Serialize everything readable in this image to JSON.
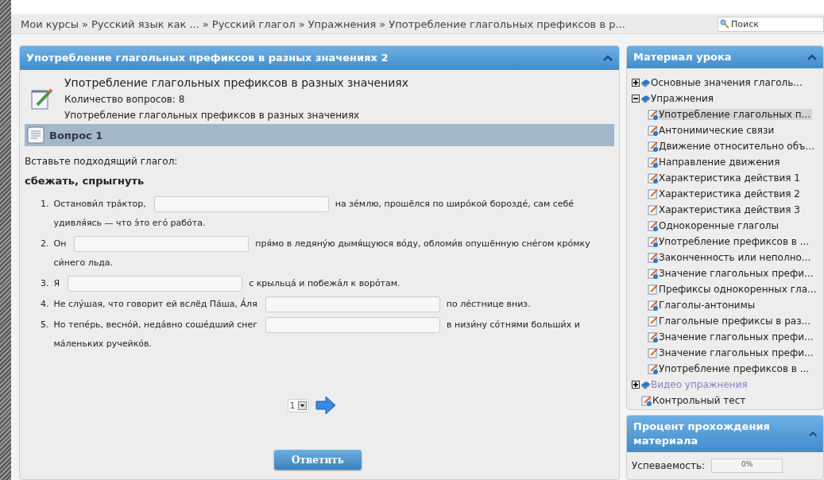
{
  "breadcrumbs": [
    "Мои курсы",
    "Русский язык как ...",
    "Русский глагол",
    "Упражнения",
    "Употребление глагольных префиксов в р..."
  ],
  "breadcrumb_separators": [
    "»",
    "»",
    "»",
    "»"
  ],
  "search": {
    "placeholder": "Поиск"
  },
  "quiz_panel": {
    "title": "Употребление глагольных префиксов в разных значениях 2",
    "quiz_title": "Употребление глагольных префиксов в разных значениях",
    "question_count": "Количество вопросов: 8",
    "description": "Употребление глагольных префиксов в разных значениях",
    "question": {
      "title": "Вопрос 1",
      "instruction": "Вставьте подходящий глагол:",
      "words": "сбежать, спрыгнуть",
      "items": [
        {
          "number": "1.",
          "before": "Останови́л тра́ктор,",
          "after": "на зе́млю, прошёлся по широ́кой борозде́, сам себе́",
          "continuation": "удивля́ясь — что э́то его́ рабо́та."
        },
        {
          "number": "2.",
          "before": "Он",
          "after": "пря́мо в ледяну́ю дымя́щуюся во́ду, обломи́в опушённую сне́гом кро́мку",
          "continuation": "си́него льда."
        },
        {
          "number": "3.",
          "before": "Я",
          "after": "с крыльца́ и побежа́л к воро́там."
        },
        {
          "number": "4.",
          "before": "Не слу́шая, что говорит ей вслёд Па́ша, А́ля",
          "after": "по ле́стнице вниз."
        },
        {
          "number": "5.",
          "before": "Но тепе́рь, весно́й, неда́вно соше́дший снег",
          "after": "в низи́ну со́тнями больши́х и",
          "continuation": "ма́леньких ручейко́в."
        }
      ]
    },
    "page_select": {
      "value": "1"
    },
    "submit_button": "Ответить"
  },
  "material_panel": {
    "title": "Материал урока",
    "tree": [
      {
        "label": "Основные значения глаголь...",
        "kind": "folder",
        "expanded": false,
        "visited": false
      },
      {
        "label": "Упражнения",
        "kind": "folder",
        "expanded": true,
        "visited": false,
        "children": [
          {
            "label": "Употребление глагольных п...",
            "kind": "quiz",
            "selected": true
          },
          {
            "label": "Антонимические связи",
            "kind": "quiz",
            "selected": false
          },
          {
            "label": "Движение относительно объ...",
            "kind": "quiz",
            "selected": false
          },
          {
            "label": "Направление движения",
            "kind": "quiz",
            "selected": false
          },
          {
            "label": "Характеристика действия 1",
            "kind": "quiz",
            "selected": false
          },
          {
            "label": "Характеристика действия 2",
            "kind": "task",
            "selected": false
          },
          {
            "label": "Характеристика действия 3",
            "kind": "task",
            "selected": false
          },
          {
            "label": "Однокоренные глаголы",
            "kind": "quiz",
            "selected": false
          },
          {
            "label": "Употребление префиксов в ...",
            "kind": "quiz",
            "selected": false
          },
          {
            "label": "Законченность или неполно...",
            "kind": "quiz",
            "selected": false
          },
          {
            "label": "Значение глагольных префи...",
            "kind": "quiz",
            "selected": false
          },
          {
            "label": "Префиксы однокоренных гла...",
            "kind": "task",
            "selected": false
          },
          {
            "label": "Глаголы-антонимы",
            "kind": "quiz",
            "selected": false
          },
          {
            "label": "Глагольные префиксы в раз...",
            "kind": "task",
            "selected": false
          },
          {
            "label": "Значение глагольных префи...",
            "kind": "quiz",
            "selected": false
          },
          {
            "label": "Значение глагольных префи...",
            "kind": "task",
            "selected": false
          },
          {
            "label": "Употребление префиксов в ...",
            "kind": "quiz",
            "selected": false
          }
        ]
      },
      {
        "label": "Видео упражнения",
        "kind": "folder",
        "expanded": false,
        "visited": true
      },
      {
        "label": "Контрольный тест",
        "kind": "quiz",
        "selected": false
      }
    ]
  },
  "progress_panel": {
    "title": "Процент прохождения материала",
    "label": "Успеваемость:",
    "level": 0,
    "reading": "0%"
  }
}
